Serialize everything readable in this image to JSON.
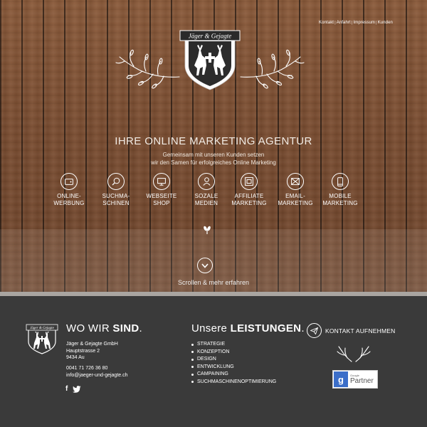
{
  "nav": {
    "items": [
      "Kontakt",
      "Anfahrt",
      "Impressum",
      "Kunden"
    ],
    "separator": "|"
  },
  "logo": {
    "text": "Jäger & Gejagte"
  },
  "hero": {
    "tagline": "IHRE ONLINE MARKETING AGENTUR",
    "subline1": "Gemeinsam mit unseren Kunden setzen",
    "subline2": "wir den Samen für erfolgreiches Online Marketing"
  },
  "services": [
    {
      "line1": "ONLINE-",
      "line2": "WERBUNG",
      "icon": "wallet-icon"
    },
    {
      "line1": "SUCHMA-",
      "line2": "SCHINEN",
      "icon": "magnifier-icon"
    },
    {
      "line1": "WEBSEITE",
      "line2": "SHOP",
      "icon": "monitor-icon"
    },
    {
      "line1": "SOZALE",
      "line2": "MEDIEN",
      "icon": "user-icon"
    },
    {
      "line1": "AFFILIATE",
      "line2": "MARKETING",
      "icon": "window-icon"
    },
    {
      "line1": "EMAIL-",
      "line2": "MARKETING",
      "icon": "envelope-icon"
    },
    {
      "line1": "MOBILE",
      "line2": "MARKETING",
      "icon": "smartphone-icon"
    }
  ],
  "scroll": {
    "text": "Scrollen & mehr erfahren"
  },
  "footer": {
    "where": {
      "prefix": "WO WIR ",
      "bold": "SIND",
      "suffix": "."
    },
    "address": [
      "Jäger & Gejagte GmbH",
      "Hauptstrasse 2",
      "9434 Au"
    ],
    "phone": "0041 71 726 36 80",
    "email": "info@jaeger-und-gejagte.ch",
    "social": [
      "f",
      "twitter"
    ],
    "services_heading": {
      "prefix": "Unsere ",
      "bold": "LEISTUNGEN",
      "suffix": "."
    },
    "services_list": [
      "STRATEGIE",
      "KONZEPTION",
      "DESIGN",
      "ENTWICKLUNG",
      "CAMPAINING",
      "SUCHMASCHINENOPTIMIERUNG"
    ],
    "contact_button": "KONTAKT AUFNEHMEN",
    "badge": {
      "small": "Google",
      "large": "Partner"
    }
  },
  "colors": {
    "wood": "#7b4f33",
    "footer_bg": "#3a3a3a",
    "footer_band": "#a9a5a1",
    "google_blue": "#3b6ec9"
  }
}
